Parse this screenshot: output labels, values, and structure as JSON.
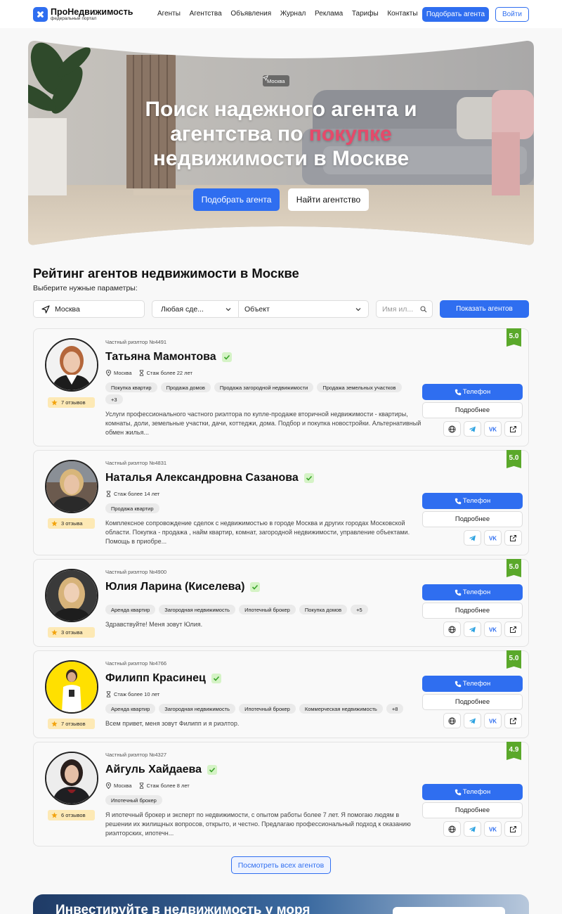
{
  "header": {
    "logo_title": "ПроНедвижимость",
    "logo_sub": "федеральный портал",
    "nav": [
      "Агенты",
      "Агентства",
      "Объявления",
      "Журнал",
      "Реклама",
      "Тарифы",
      "Контакты"
    ],
    "cta": "Подобрать агента",
    "login": "Войти"
  },
  "hero": {
    "location": "Москва",
    "title_line1": "Поиск надежного агента и",
    "title_line2_pre": "агентства по ",
    "title_highlight": "покупке",
    "title_line3": "недвижимости в Москве",
    "btn_primary": "Подобрать агента",
    "btn_secondary": "Найти агентство"
  },
  "rating": {
    "title": "Рейтинг агентов недвижимости в Москве",
    "subtitle": "Выберите нужные параметры:",
    "filters": {
      "city": "Москва",
      "deal": "Любая сде...",
      "object": "Объект",
      "name_placeholder": "Имя ил...",
      "submit": "Показать агентов"
    }
  },
  "agents": [
    {
      "id": "Частный риэлтор №4491",
      "name": "Татьяна Мамонтова",
      "city": "Москва",
      "experience": "Стаж более 22 лет",
      "tags": [
        "Покупка квартир",
        "Продажа домов",
        "Продажа загородной недвижимости",
        "Продажа земельных участков",
        "+3"
      ],
      "description": "Услуги профессионального частного риэлтора по купле-продаже вторичной недвижимости - квартиры, комнаты, доли, земельные участки, дачи, коттеджи, дома. Подбор и покупка новостройки. Альтернативный обмен жилья...",
      "reviews": "7 отзывов",
      "rating": "5.0"
    },
    {
      "id": "Частный риэлтор №4831",
      "name": "Наталья Александровна Сазанова",
      "city": "",
      "experience": "Стаж более 14 лет",
      "tags": [
        "Продажа квартир"
      ],
      "description": "Комплексное сопровождение сделок с недвижимостью в городе Москва и других городах Московской области. Покупка - продажа , найм квартир, комнат, загородной недвижимости, управление объектами. Помощь в приобре...",
      "reviews": "3 отзыва",
      "rating": "5.0"
    },
    {
      "id": "Частный риэлтор №4900",
      "name": "Юлия Ларина (Киселева)",
      "city": "",
      "experience": "",
      "tags": [
        "Аренда квартир",
        "Загородная недвижимость",
        "Ипотечный брокер",
        "Покупка домов",
        "+5"
      ],
      "description": "Здравствуйте! Меня зовут Юлия.",
      "reviews": "3 отзыва",
      "rating": "5.0"
    },
    {
      "id": "Частный риэлтор №4766",
      "name": "Филипп Красинец",
      "city": "",
      "experience": "Стаж более 10 лет",
      "tags": [
        "Аренда квартир",
        "Загородная недвижимость",
        "Ипотечный брокер",
        "Коммерческая недвижимость",
        "+8"
      ],
      "description": "Всем привет, меня зовут Филипп и я риэлтор.",
      "reviews": "7 отзывов",
      "rating": "5.0"
    },
    {
      "id": "Частный риэлтор №4327",
      "name": "Айгуль Хайдаева",
      "city": "Москва",
      "experience": "Стаж более 8 лет",
      "tags": [
        "Ипотечный брокер"
      ],
      "description": "Я ипотечный брокер и эксперт по недвижимости, с опытом работы более 7 лет. Я помогаю людям в решении их жилищных вопросов, открыто, и честно. Предлагаю профессиональный подход к оказанию риэлторских, ипотечн...",
      "reviews": "6 отзывов",
      "rating": "4.9"
    }
  ],
  "card_buttons": {
    "phone": "Телефон",
    "more": "Подробнее"
  },
  "show_all": "Посмотреть всех агентов",
  "promo": {
    "title": "Инвестируйте в недвижимость у моря"
  },
  "colors": {
    "accent": "#2f6ef0",
    "highlight": "#e54a6a",
    "rating": "#5aa82a",
    "reviews_bg": "#fde9b5"
  }
}
